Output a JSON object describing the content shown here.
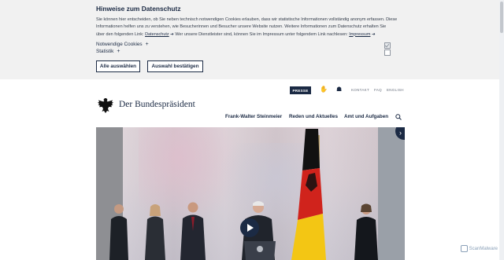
{
  "cookie": {
    "title": "Hinweise zum Datenschutz",
    "line1": "Sie können hier entscheiden, ob Sie neben technisch notwendigen Cookies erlauben, dass wir statistische Informationen vollständig anonym erfassen. Diese",
    "line2": "Informationen helfen uns zu verstehen, wie Besucherinnen und Besucher unsere Website nutzen. Weitere Informationen zum Datenschutz erhalten Sie",
    "line3_pre": "über den folgenden Link: ",
    "link_datenschutz": "Datenschutz",
    "line3_mid": " Wer unsere Dienstleister sind, können Sie im Impressum unter folgendem Link nachlesen: ",
    "link_impressum": "Impressum",
    "option_necessary": "Notwendige Cookies",
    "option_statistics": "Statistik",
    "button_select_all": "Alle auswählen",
    "button_confirm": "Auswahl bestätigen"
  },
  "header": {
    "presse": "PRESSE",
    "kontakt": "KONTAKT",
    "faq": "FAQ",
    "english": "ENGLISH",
    "logo_text": "Der Bundespräsident"
  },
  "nav": {
    "items": [
      "Frank-Walter Steinmeier",
      "Reden und Aktuelles",
      "Amt und Aufgaben"
    ]
  },
  "hero": {
    "next_glyph": "›"
  },
  "watermark": {
    "text": "ScanMalware"
  },
  "colors": {
    "navy": "#1b2a44",
    "banner_bg": "#f1f1f1",
    "flag_black": "#111111",
    "flag_red": "#d0231c",
    "flag_gold": "#f3c614"
  },
  "icons": [
    "sign-language-icon",
    "easy-language-icon",
    "search-icon",
    "play-icon",
    "next-arrow-icon",
    "plus-icon"
  ]
}
